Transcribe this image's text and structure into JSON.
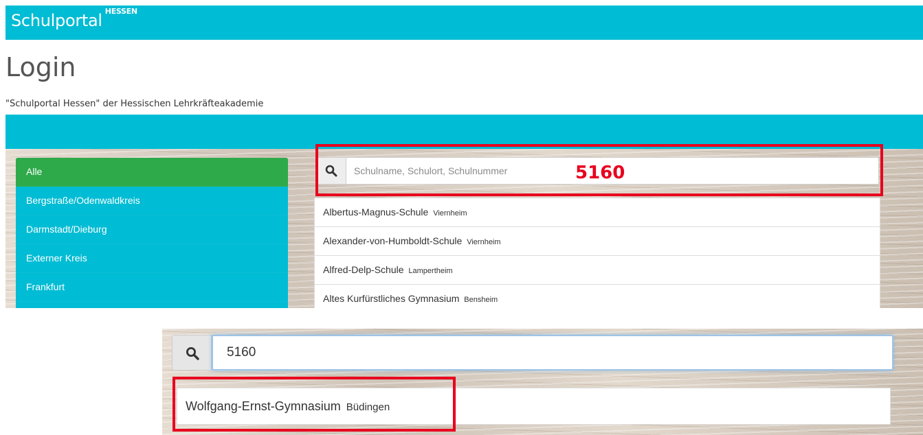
{
  "header": {
    "brand": "Schulportal",
    "brand_sup": "HESSEN"
  },
  "page": {
    "title": "Login",
    "subtitle": "\"Schulportal Hessen\" der Hessischen Lehrkräfteakademie"
  },
  "sidebar": {
    "items": [
      {
        "label": "Alle",
        "active": true
      },
      {
        "label": "Bergstraße/Odenwaldkreis"
      },
      {
        "label": "Darmstadt/Dieburg"
      },
      {
        "label": "Externer Kreis"
      },
      {
        "label": "Frankfurt"
      }
    ]
  },
  "search": {
    "placeholder": "Schulname, Schulort, Schulnummer",
    "icon": "search-icon"
  },
  "annotation": {
    "number": "5160",
    "color": "#e8001e"
  },
  "results": [
    {
      "name": "Albertus-Magnus-Schule",
      "place": "Viernheim"
    },
    {
      "name": "Alexander-von-Humboldt-Schule",
      "place": "Viernheim"
    },
    {
      "name": "Alfred-Delp-Schule",
      "place": "Lampertheim"
    },
    {
      "name": "Altes Kurfürstliches Gymnasium",
      "place": "Bensheim"
    }
  ],
  "search_filtered": {
    "value": "5160",
    "result": {
      "name": "Wolfgang-Ernst-Gymnasium",
      "place": "Büdingen"
    }
  },
  "colors": {
    "brand": "#00bcd4",
    "active": "#2eaa4a",
    "highlight": "#e8001e"
  }
}
